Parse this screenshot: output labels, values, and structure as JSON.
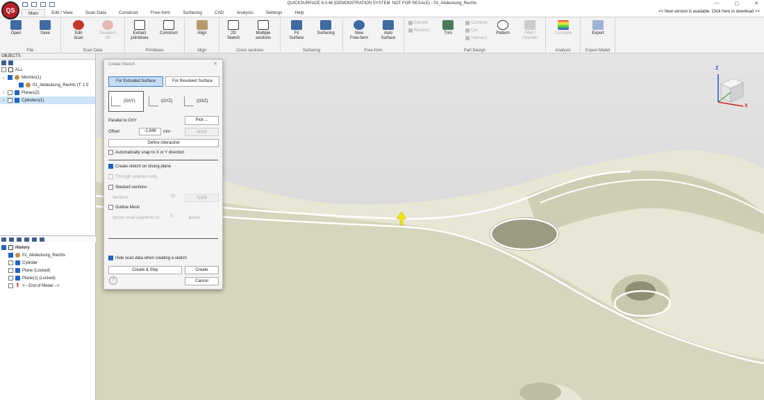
{
  "window": {
    "title": "QUICKSURFACE 6.0.46 (DEMONSTRATION SYSTEM. NOT FOR RESALE) - 01_Abdeckung_Rechts",
    "logo": "QS",
    "controls": [
      "—",
      "▢",
      "✕"
    ],
    "update_notice": "<< New version is available. Click here to download >>"
  },
  "tabs": [
    "Main",
    "Edit / View",
    "Scan Data",
    "Construct",
    "Free-form",
    "Surfacing",
    "CAD",
    "Analysis",
    "Settings",
    "Help"
  ],
  "ribbon": {
    "groups": [
      {
        "label": "File",
        "buttons": [
          "Open",
          "Save"
        ]
      },
      {
        "label": "Scan Data",
        "buttons": [
          "Edit\nScan",
          "Deselect\nAll"
        ]
      },
      {
        "label": "Primitives",
        "buttons": [
          "Extract\nprimitives",
          "Construct"
        ]
      },
      {
        "label": "Align",
        "buttons": [
          "Align"
        ]
      },
      {
        "label": "Cross sections",
        "buttons": [
          "2D\nSketch",
          "Multiple\nsections"
        ]
      },
      {
        "label": "Surfacing",
        "buttons": [
          "Fit\nSurface",
          "Surfacing"
        ]
      },
      {
        "label": "Free-form",
        "buttons": [
          "New\nFree-form",
          "Auto\nSurface"
        ]
      },
      {
        "label": "Part Design",
        "buttons": [
          "Trim",
          "Pattern",
          "Fillet /\nChamfer"
        ],
        "small": [
          "Extrude",
          "Revolve",
          "Combine",
          "Cut",
          "Intersect"
        ]
      },
      {
        "label": "Analysis",
        "buttons": [
          "Compare"
        ]
      },
      {
        "label": "Export Model",
        "buttons": [
          "Export"
        ]
      }
    ]
  },
  "objects": {
    "title": "OBJECTS",
    "items": [
      {
        "label": "ALL"
      },
      {
        "label": "Meshes(1)"
      },
      {
        "label": "01_Abdeckung_Rechts (T: 1 0"
      },
      {
        "label": "Planes(2)"
      },
      {
        "label": "Cylinders(1)"
      }
    ]
  },
  "history": {
    "title": "History",
    "items": [
      "01_Abdeckung_Rechts",
      "Cylinder",
      "Plane (Locked)",
      "Plane(1) (Locked)",
      "<-- End of Model -->"
    ]
  },
  "dialog": {
    "title": "Create Sketch",
    "close": "✕",
    "extruded": "For Extruded Surface",
    "revolved": "For Revolved Surface",
    "planes": [
      "(OXY)",
      "(OYZ)",
      "(OXZ)"
    ],
    "parallel_label": "Parallel to OXY",
    "pick": "Pick ...",
    "offset_label": "Offset",
    "offset_value": "-2.849",
    "unit": "mm",
    "apply": "Apply",
    "define_interactive": "Define interactive",
    "auto_snap": "Automatically snap to X or Y direction",
    "slicing": "Create sketch on slicing plane",
    "through": "Through selection only",
    "stacked": "Stacked sections",
    "sections_label": "Sections",
    "sections_value": "20",
    "apply2": "Apply",
    "outline": "Outline Mesh",
    "ignore_label": "Ignore small segments of",
    "ignore_value": "5",
    "points": "points",
    "hide_scan": "Hide scan data when creating a sketch",
    "create_stay": "Create & Stay",
    "create": "Create",
    "cancel": "Cancel",
    "help": "?"
  },
  "viewcube": {
    "z": "Z",
    "x": "X"
  }
}
